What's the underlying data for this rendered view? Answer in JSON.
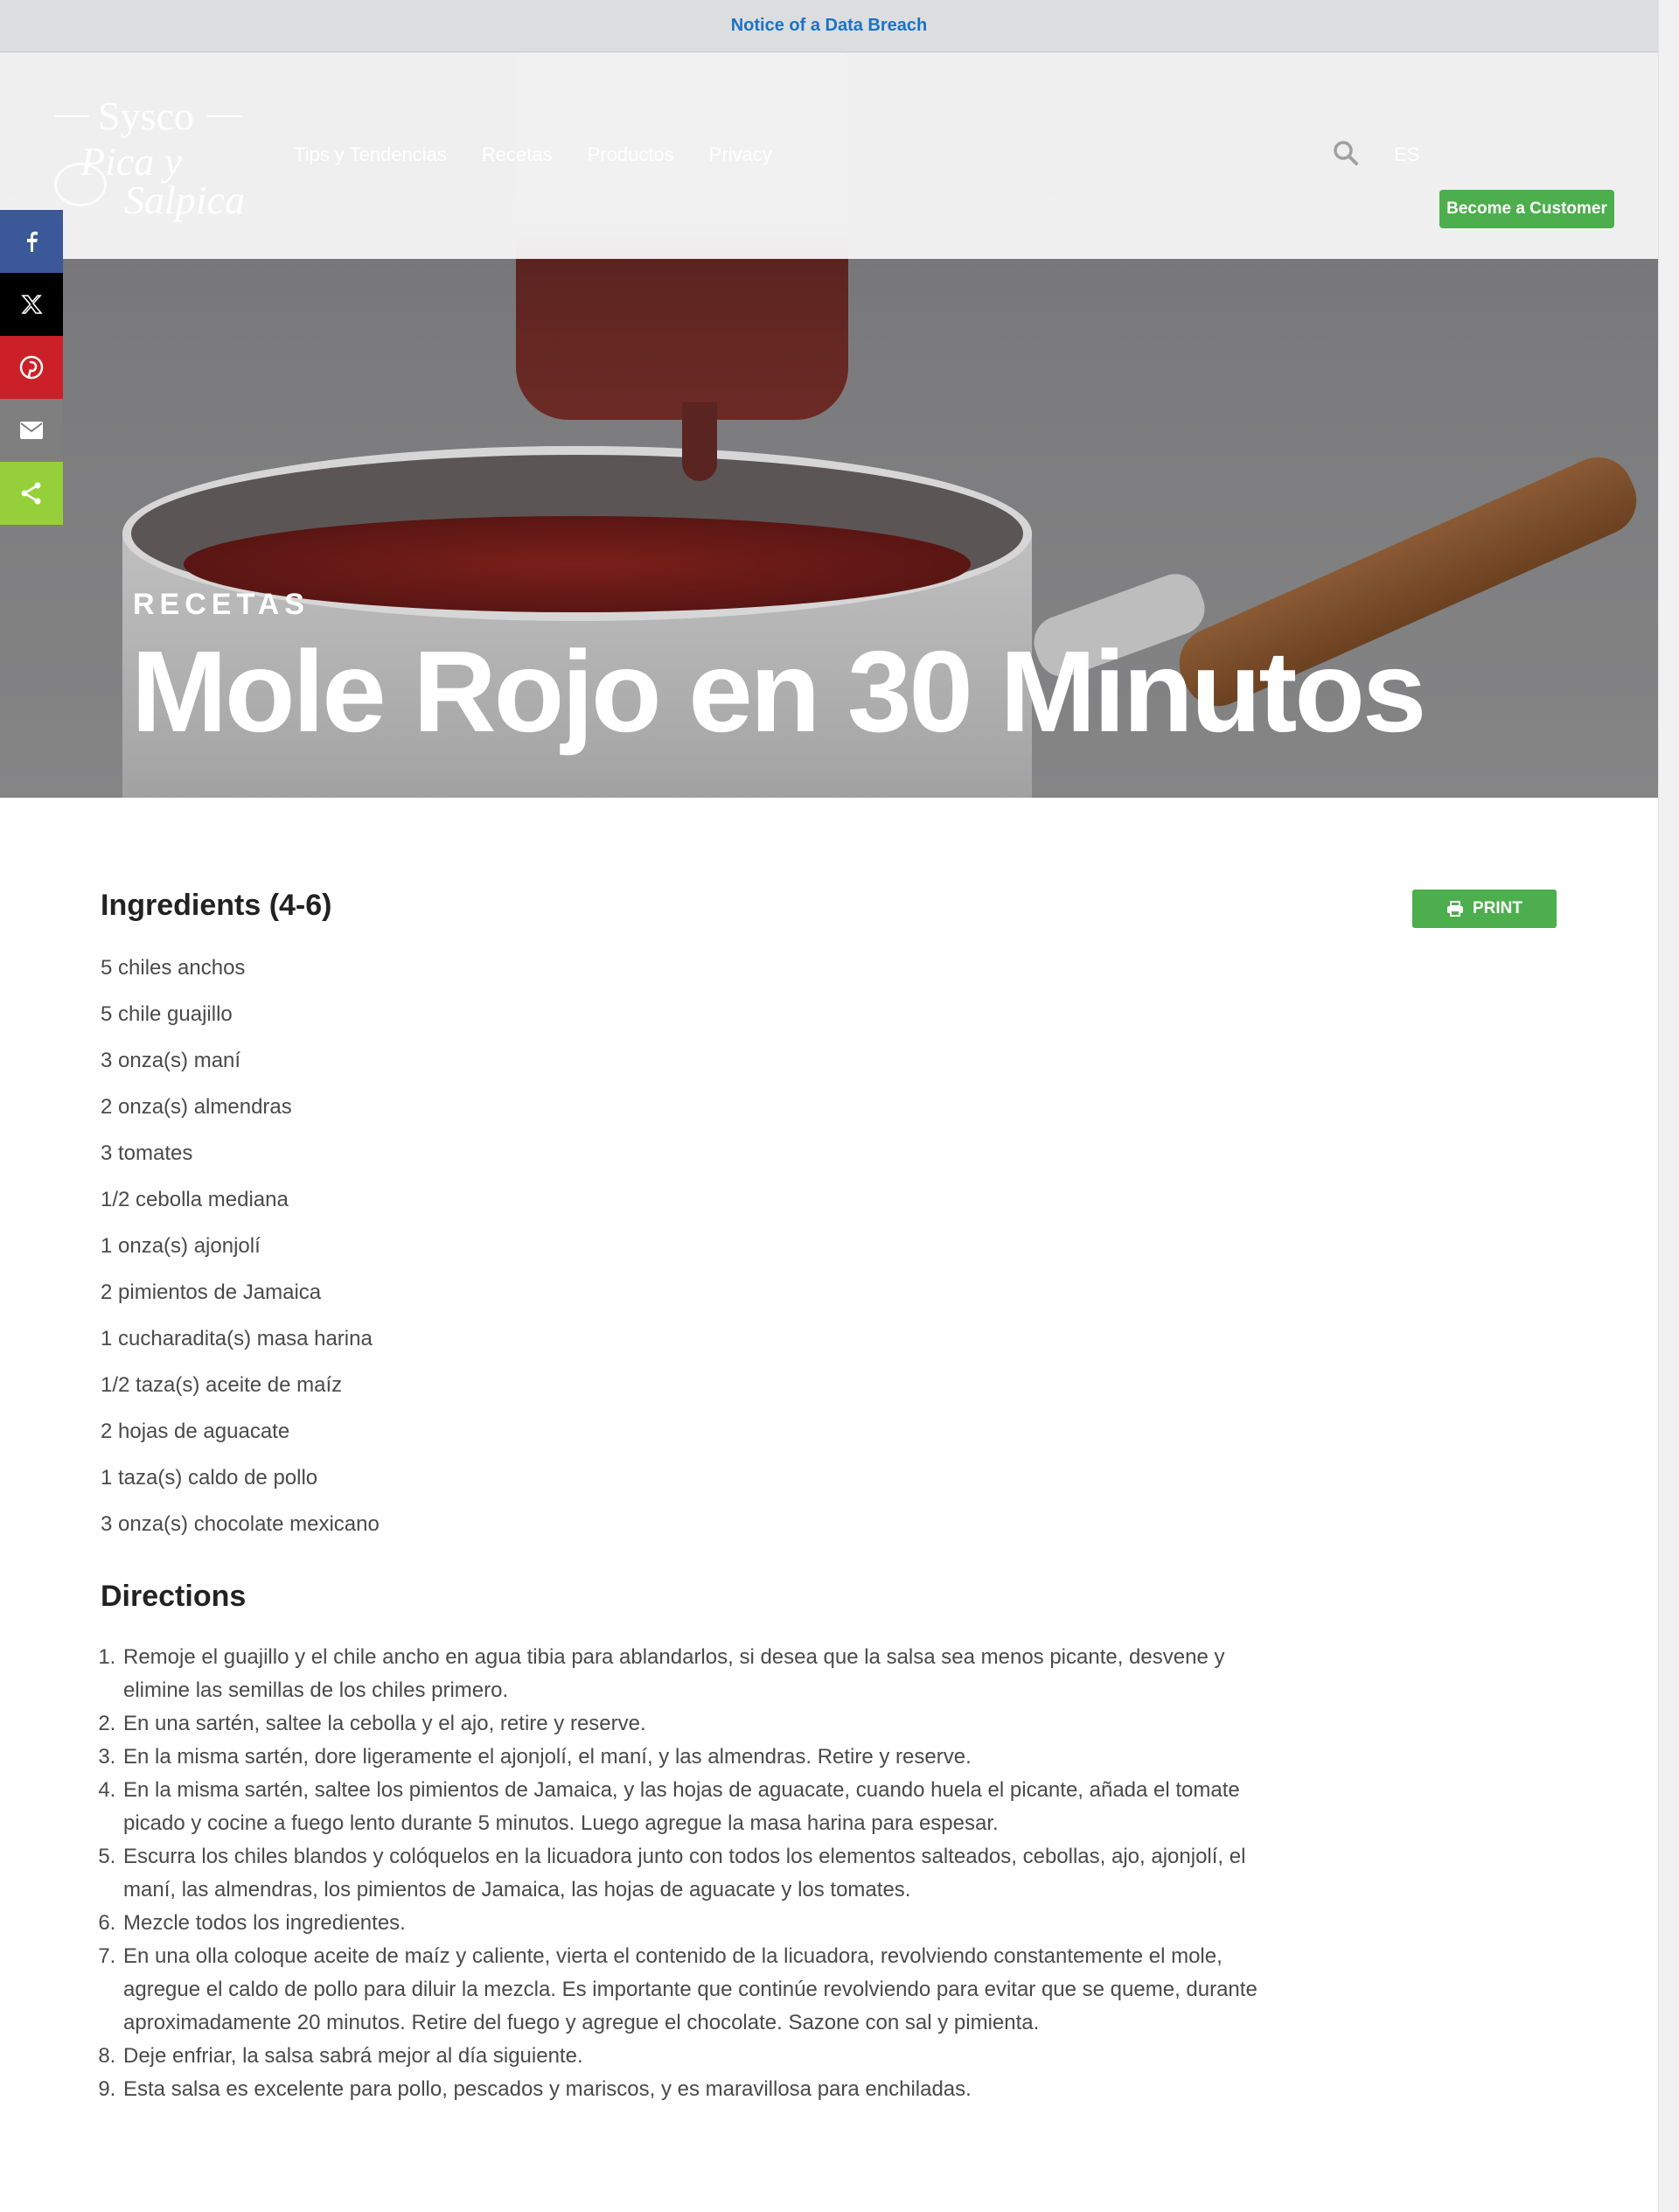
{
  "notice": {
    "text": "Notice of a Data Breach"
  },
  "header": {
    "logo_text_top": "Sysco",
    "logo_text_mid": "Pica y",
    "logo_text_bottom": "Salpica",
    "nav": [
      "Tips y Tendencias",
      "Recetas",
      "Productos",
      "Privacy"
    ],
    "lang": "ES",
    "cta": "Become a Customer"
  },
  "share": [
    "facebook-icon",
    "x-icon",
    "pinterest-icon",
    "email-icon",
    "share-icon"
  ],
  "hero": {
    "eyebrow": "RECETAS",
    "title": "Mole Rojo en 30 Minutos"
  },
  "recipe": {
    "ingredients_title": "Ingredients (4-6)",
    "print_label": "PRINT",
    "ingredients": [
      "5 chiles anchos",
      "5 chile guajillo",
      "3 onza(s) maní",
      "2 onza(s) almendras",
      "3 tomates",
      "1/2 cebolla mediana",
      "1 onza(s) ajonjolí",
      "2 pimientos de Jamaica",
      "1 cucharadita(s) masa harina",
      "1/2 taza(s) aceite de maíz",
      "2 hojas de aguacate",
      "1 taza(s) caldo de pollo",
      "3 onza(s) chocolate mexicano"
    ],
    "directions_title": "Directions",
    "directions": [
      "Remoje el guajillo y el chile ancho en agua tibia para ablandarlos, si desea que la salsa sea menos picante, desvene y elimine las semillas de los chiles primero.",
      "En una sartén, saltee la cebolla y el ajo, retire y reserve.",
      "En la misma sartén, dore ligeramente el ajonjolí, el maní, y las almendras. Retire y reserve.",
      "En la misma sartén, saltee los pimientos de Jamaica, y las hojas de aguacate, cuando huela el picante, añada el tomate picado y cocine a fuego lento durante 5 minutos. Luego agregue la masa harina para espesar.",
      "Escurra los chiles blandos y colóquelos en la licuadora junto con todos los elementos salteados, cebollas, ajo, ajonjolí, el maní, las almendras, los pimientos de Jamaica, las hojas de aguacate y los tomates.",
      "Mezcle todos los ingredientes.",
      "En una olla coloque aceite de maíz y caliente, vierta el contenido de la licuadora, revolviendo constantemente el mole, agregue el caldo de pollo para diluir la mezcla. Es importante que continúe revolviendo para evitar que se queme, durante aproximadamente 20 minutos. Retire del fuego y agregue el chocolate. Sazone con sal y pimienta.",
      "Deje enfriar, la salsa sabrá mejor al día siguiente.",
      "Esta salsa es excelente para pollo, pescados y mariscos, y es maravillosa para enchiladas."
    ]
  },
  "colors": {
    "accent_green": "#4cae4c",
    "link_blue": "#1a73c6",
    "facebook": "#3b5998",
    "pinterest": "#cb2027",
    "share_green": "#95d03a"
  }
}
